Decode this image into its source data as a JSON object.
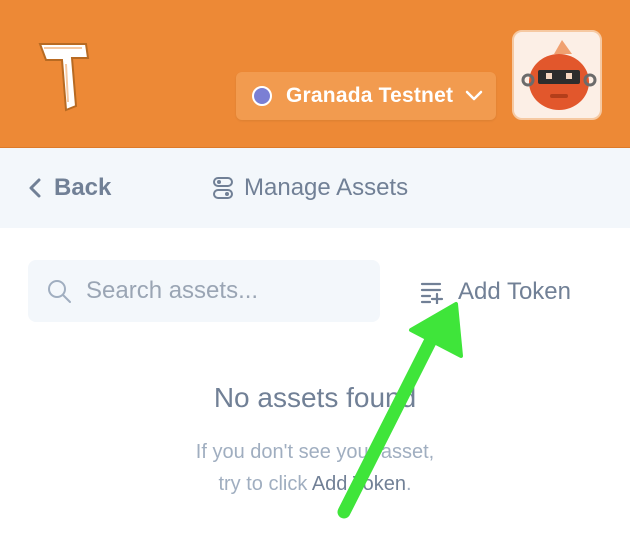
{
  "header": {
    "network": {
      "label": "Granada Testnet",
      "dot_color": "#7b7fd4"
    },
    "logo_icon": "temple-logo-icon",
    "avatar_icon": "robot-avatar-icon",
    "accent": "#ed8936"
  },
  "subnav": {
    "back_label": "Back",
    "title": "Manage Assets",
    "title_icon": "toggles-icon"
  },
  "search": {
    "placeholder": "Search assets...",
    "value": ""
  },
  "add_token": {
    "label": "Add Token",
    "icon": "list-add-icon"
  },
  "empty_state": {
    "title": "No assets found",
    "line1": "If you don't see your asset,",
    "line2_prefix": "try to click ",
    "line2_link": "Add Token",
    "line2_suffix": "."
  },
  "annotation": {
    "arrow_color": "#3fe53a"
  }
}
